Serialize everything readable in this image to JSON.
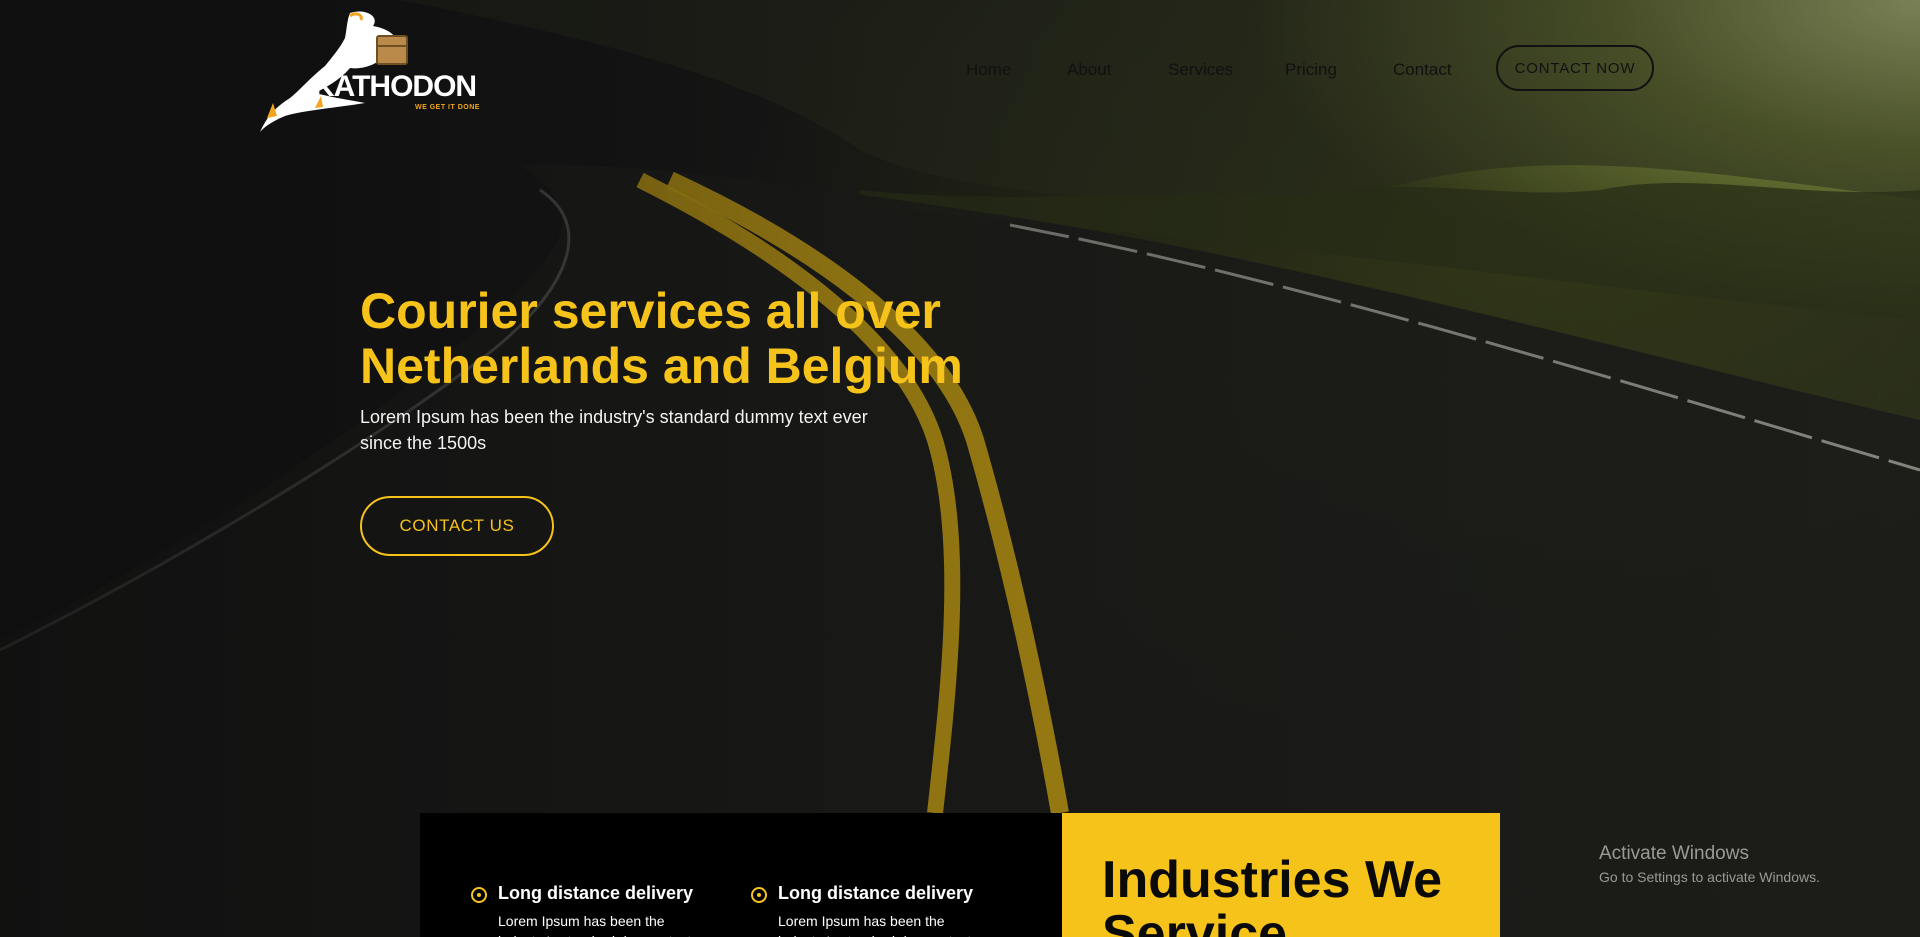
{
  "brand": {
    "name": "KATHODON",
    "tagline": "WE GET IT DONE"
  },
  "nav": {
    "items": [
      {
        "label": "Home"
      },
      {
        "label": "About"
      },
      {
        "label": "Services"
      },
      {
        "label": "Pricing"
      },
      {
        "label": "Contact"
      }
    ],
    "cta": "CONTACT NOW"
  },
  "hero": {
    "title": "Courier services all over Netherlands and Belgium",
    "subtitle": "Lorem Ipsum has been the industry's standard dummy text ever since the 1500s",
    "cta": "CONTACT US"
  },
  "services": [
    {
      "title": "Long distance delivery",
      "text": "Lorem Ipsum has been the industry's standard dummy text"
    },
    {
      "title": "Long distance delivery",
      "text": "Lorem Ipsum has been the industry's standard dummy text"
    }
  ],
  "industries": {
    "title": "Industries We Service"
  },
  "windows_watermark": {
    "title": "Activate Windows",
    "subtitle": "Go to Settings to activate Windows."
  },
  "colors": {
    "accent": "#f6c31a",
    "dark": "#111111",
    "logo_orange": "#f2a51d"
  }
}
